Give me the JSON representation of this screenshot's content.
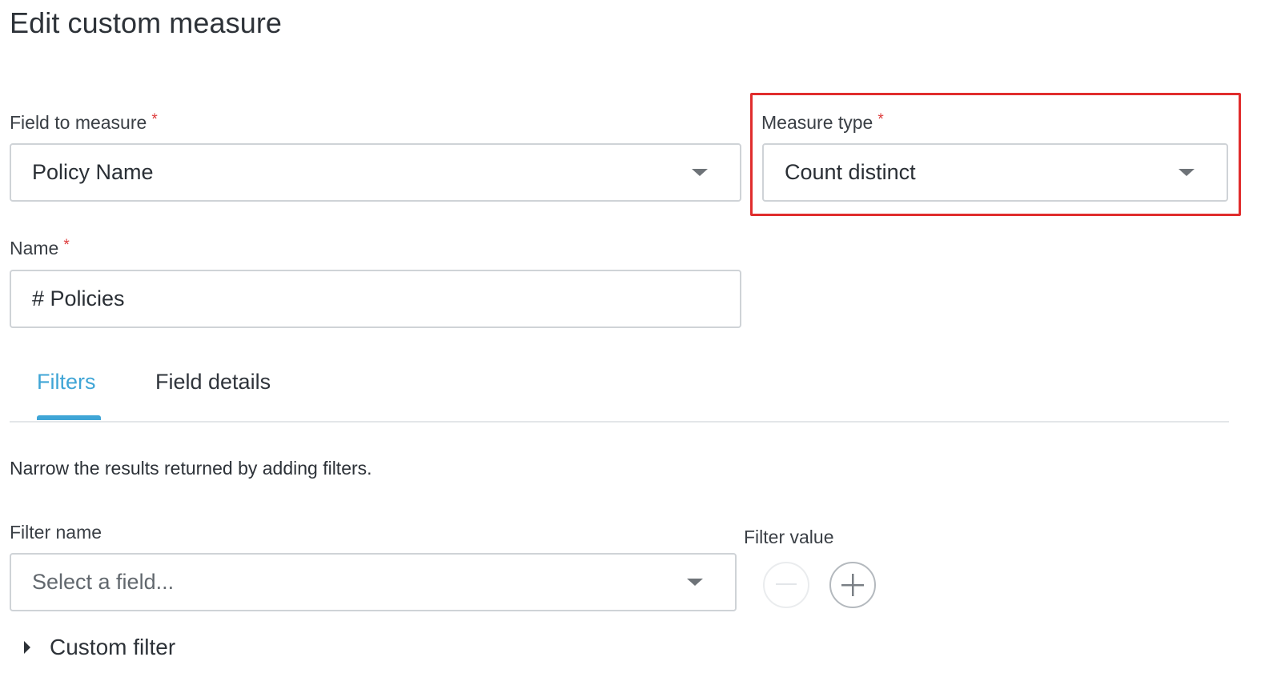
{
  "page": {
    "title": "Edit custom measure",
    "help_text": "Narrow the results returned by adding filters.",
    "required_marker": "*"
  },
  "field_to_measure": {
    "label": "Field to measure",
    "value": "Policy Name"
  },
  "measure_type": {
    "label": "Measure type",
    "value": "Count distinct"
  },
  "name_field": {
    "label": "Name",
    "value": "# Policies"
  },
  "tabs": [
    {
      "label": "Filters",
      "active": true
    },
    {
      "label": "Field details",
      "active": false
    }
  ],
  "filters": {
    "name_label": "Filter name",
    "name_placeholder": "Select a field...",
    "value_label": "Filter value",
    "custom_filter_label": "Custom filter"
  },
  "colors": {
    "accent": "#3fa5d6",
    "highlight": "#e02d2d",
    "required": "#dd3b3b"
  }
}
